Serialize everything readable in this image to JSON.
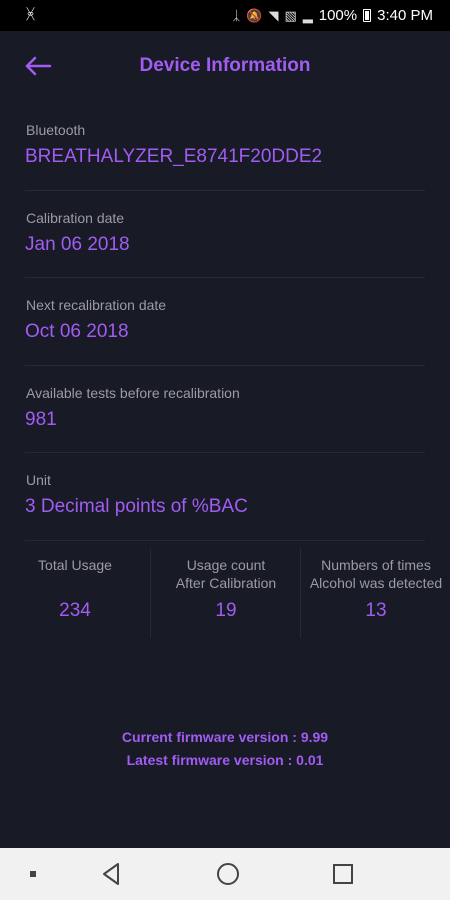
{
  "status_bar": {
    "usb_icon": "usb-icon",
    "battery_percent": "100%",
    "time": "3:40 PM"
  },
  "header": {
    "title": "Device Information",
    "back_icon": "back-arrow-icon"
  },
  "info": [
    {
      "label": "Bluetooth",
      "value": "BREATHALYZER_E8741F20DDE2"
    },
    {
      "label": "Calibration date",
      "value": "Jan 06 2018"
    },
    {
      "label": "Next recalibration date",
      "value": "Oct 06 2018"
    },
    {
      "label": "Available tests before recalibration",
      "value": "981"
    },
    {
      "label": "Unit",
      "value": "3 Decimal points of %BAC"
    }
  ],
  "stats": [
    {
      "label_line1": "Total Usage",
      "label_line2": "",
      "value": "234"
    },
    {
      "label_line1": "Usage count",
      "label_line2": "After Calibration",
      "value": "19"
    },
    {
      "label_line1": "Numbers of times",
      "label_line2": "Alcohol was detected",
      "value": "13"
    }
  ],
  "firmware": {
    "current": "Current firmware version : 9.99",
    "latest": "Latest firmware version : 0.01"
  },
  "colors": {
    "background": "#181a26",
    "accent": "#a15cf2",
    "label": "#9c9aa6",
    "nav_bar": "#f1f1f1"
  }
}
